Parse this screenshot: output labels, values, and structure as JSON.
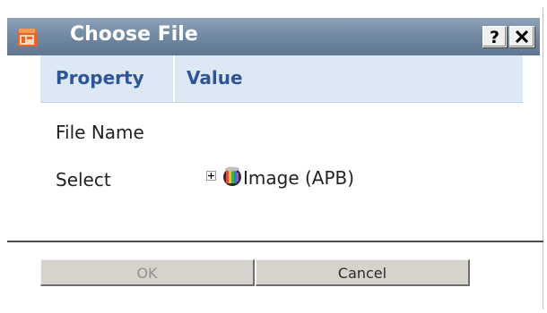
{
  "dialog": {
    "title": "Choose File",
    "help_label": "?",
    "icons": {
      "app": "app-icon",
      "help": "help-icon",
      "close": "close-icon"
    }
  },
  "grid": {
    "columns": [
      "Property",
      "Value"
    ],
    "rows": [
      {
        "property": "File Name",
        "value": ""
      },
      {
        "property": "Select",
        "value": ""
      }
    ],
    "tree": {
      "node_label": "Image (APB)",
      "expanded": false,
      "icon": "image-library-icon"
    }
  },
  "buttons": {
    "ok": "OK",
    "cancel": "Cancel",
    "ok_enabled": false
  },
  "colors": {
    "titlebar": "#6f86a0",
    "header_bg": "#dde8f5",
    "header_text": "#2f5597",
    "button_bg": "#d6d3cd"
  }
}
